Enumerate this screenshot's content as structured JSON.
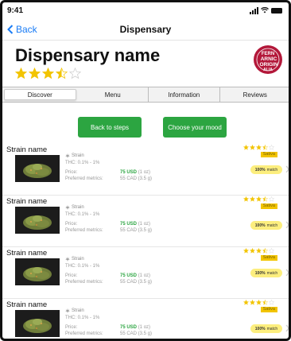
{
  "status": {
    "time": "9:41"
  },
  "nav": {
    "back_label": "Back",
    "title": "Dispensary"
  },
  "dispensary": {
    "name": "Dispensary name",
    "rating": 3.5,
    "logo_text": "FERN ARNIC ORIGIN ALIA"
  },
  "tabs": [
    {
      "label": "Discover",
      "active": true
    },
    {
      "label": "Menu",
      "active": false
    },
    {
      "label": "Information",
      "active": false
    },
    {
      "label": "Reviews",
      "active": false
    }
  ],
  "actions": {
    "back_label": "Back to steps",
    "mood_label": "Choose your mood"
  },
  "strains": [
    {
      "name": "Strain name",
      "type_label": "Strain",
      "thc": "THC: 0.1% - 1%",
      "price_label": "Price:",
      "price": "75 USD",
      "price_unit": "(1 oz)",
      "metrics_label": "Preferred metrics:",
      "metrics_value": "55 CAD (3.5 g)",
      "rating": 3.5,
      "category": "Sativa",
      "match_pct": "100%",
      "match_label": "match"
    },
    {
      "name": "Strain name",
      "type_label": "Strain",
      "thc": "THC: 0.1% - 1%",
      "price_label": "Price:",
      "price": "75 USD",
      "price_unit": "(1 oz)",
      "metrics_label": "Preferred metrics:",
      "metrics_value": "55 CAD (3.5 g)",
      "rating": 3.5,
      "category": "Sativa",
      "match_pct": "100%",
      "match_label": "match"
    },
    {
      "name": "Strain name",
      "type_label": "Strain",
      "thc": "THC: 0.1% - 1%",
      "price_label": "Price:",
      "price": "75 USD",
      "price_unit": "(1 oz)",
      "metrics_label": "Preferred metrics:",
      "metrics_value": "55 CAD (3.5 g)",
      "rating": 3.5,
      "category": "Sativa",
      "match_pct": "100%",
      "match_label": "match"
    },
    {
      "name": "Strain name",
      "type_label": "Strain",
      "thc": "THC: 0.1% - 1%",
      "price_label": "Price:",
      "price": "75 USD",
      "price_unit": "(1 oz)",
      "metrics_label": "Preferred metrics:",
      "metrics_value": "55 CAD (3.5 g)",
      "rating": 3.5,
      "category": "Sativa",
      "match_pct": "100%",
      "match_label": "match"
    }
  ],
  "colors": {
    "accent_blue": "#1a7cf5",
    "button_green": "#2ca541",
    "star_gold": "#f2c400",
    "match_yellow": "#fcee7e",
    "logo_red": "#b3183a"
  },
  "icons": {
    "back": "chevron-left-icon",
    "star": "star-icon",
    "leaf": "leaf-icon",
    "row_chevron": "chevron-right-icon"
  }
}
